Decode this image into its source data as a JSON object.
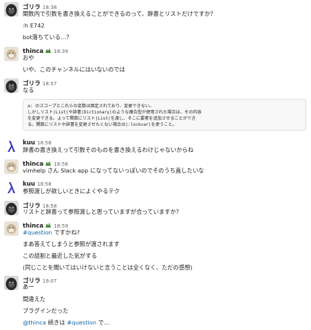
{
  "messages": [
    {
      "user": "ゴリラ",
      "time": "18:38",
      "lines": [
        "関数内で引数を書き換えることができるのって、辞書とリストだけですか？",
        ":h E742",
        "bot落ちている…？"
      ]
    },
    {
      "user": "thinca",
      "time": "18:39",
      "lines": [
        "おや",
        "いや、このチャンネルにはいないのでは"
      ]
    },
    {
      "user": "ゴリラ",
      "time": "18:57",
      "lines": [
        "なる"
      ]
    },
    {
      "user": "kuu",
      "time": "18:58",
      "lines": [
        "辞書の書き換えって引数そのものを書き換えるわけじゃないからね"
      ]
    },
    {
      "user": "thinca",
      "time": "18:58",
      "lines": [
        "vimhelp さん Slack app になってないっぽいのでそのうち直したいな"
      ]
    },
    {
      "user": "kuu",
      "time": "18:58",
      "lines": [
        "参照渡しが欲しいときによくやるテク"
      ]
    },
    {
      "user": "ゴリラ",
      "time": "18:58",
      "lines": [
        "リストと辞書って参照渡しと思っていますが合っていますか？"
      ]
    },
    {
      "user": "thinca",
      "time": "18:59",
      "lines_tail": [
        "まあ答えてしまうと参照が渡されます",
        "この話割と最近した気がする",
        "(同じことを聞いてはいけないと言うことは全くなく、ただの感想)"
      ]
    },
    {
      "user": "ゴリラ",
      "time": "19:07",
      "lines": [
        "あー",
        "間違えた",
        "プラグインだった"
      ]
    }
  ],
  "quote_lines": [
    "a: のスコープとこれらの変数は固定されており、変更できない。",
    "しかしリスト|List|や辞書|Dictionary|のような複合型が使用された場合は、その内容",
    "を変更できる。よって関数にリスト|List|を渡し、そこに要素を追加させることができ",
    "る。関数にリストや辞書を変更させたくない場合は|:lockvar|を使うこと。"
  ],
  "rich": {
    "q_tag": "#question",
    "q_rest": " ですかね?",
    "final_mention": "@thinca",
    "final_mid": " 続きは ",
    "final_tag": "#question",
    "final_end": " で…"
  }
}
